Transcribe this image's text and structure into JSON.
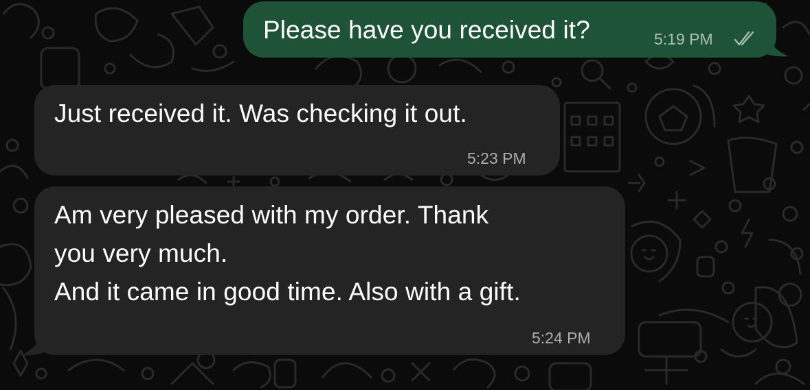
{
  "theme": {
    "background": "#0b0b0b",
    "outgoing_bubble": "#1f5338",
    "incoming_bubble": "#232423",
    "text_color": "#ffffff",
    "meta_color": "#a9a9a9"
  },
  "messages": [
    {
      "direction": "outgoing",
      "text": "Please have you received it?",
      "time": "5:19 PM",
      "status_icon": "double-check-icon"
    },
    {
      "direction": "incoming",
      "text": "Just received it. Was checking it out.",
      "time": "5:23 PM"
    },
    {
      "direction": "incoming",
      "text": "Am very pleased with my order. Thank\nyou very much.\nAnd it came in good time. Also with a gift.",
      "time": "5:24 PM"
    }
  ]
}
